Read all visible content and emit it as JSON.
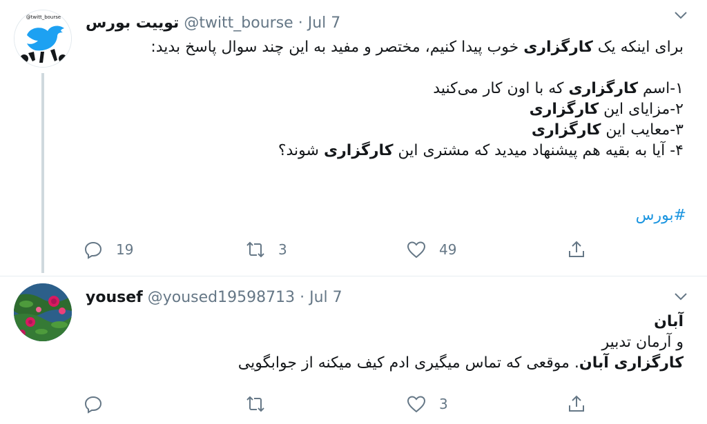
{
  "tweets": [
    {
      "display_name": "توییت بورس",
      "handle": "@twitt_bourse",
      "separator": "·",
      "date": "Jul 7",
      "avatar": {
        "text": "@twitt_bourse",
        "icon": "twitter-bird-icon",
        "accent": "#1da1f2"
      },
      "body": [
        {
          "parts": [
            {
              "t": "برای اینکه یک "
            },
            {
              "t": "کارگزاری",
              "b": true
            },
            {
              "t": " خوب پیدا کنیم، مختصر و مفید به این چند سوال پاسخ بدید:"
            }
          ]
        },
        {
          "parts": [
            {
              "t": " "
            }
          ]
        },
        {
          "parts": [
            {
              "t": "۱-اسم "
            },
            {
              "t": "کارگزاری",
              "b": true
            },
            {
              "t": " که با اون کار می‌کنید"
            }
          ]
        },
        {
          "parts": [
            {
              "t": "۲-مزایای این "
            },
            {
              "t": "کارگزاری",
              "b": true
            }
          ]
        },
        {
          "parts": [
            {
              "t": "۳-معایب این "
            },
            {
              "t": "کارگزاری",
              "b": true
            }
          ]
        },
        {
          "parts": [
            {
              "t": "۴- آیا به بقیه هم پیشنهاد میدید که مشتری این "
            },
            {
              "t": "کارگزاری",
              "b": true
            },
            {
              "t": " شوند؟"
            }
          ]
        }
      ],
      "hashtag": "#بورس",
      "actions": {
        "reply_count": "19",
        "retweet_count": "3",
        "like_count": "49"
      }
    },
    {
      "display_name": "yousef",
      "handle": "@yoused19598713",
      "separator": "·",
      "date": "Jul 7",
      "avatar": {
        "icon": "flower-photo-avatar"
      },
      "body": [
        {
          "parts": [
            {
              "t": "آبان",
              "b": true
            }
          ]
        },
        {
          "parts": [
            {
              "t": "و آرمان تدبیر"
            }
          ]
        },
        {
          "parts": [
            {
              "t": "کارگزاری آبان",
              "b": true
            },
            {
              "t": ". موقعی که تماس میگیری ادم کیف میکنه از جوابگویی"
            }
          ]
        }
      ],
      "actions": {
        "reply_count": "",
        "retweet_count": "",
        "like_count": "3"
      }
    }
  ],
  "colors": {
    "text": "#14171a",
    "muted": "#657786",
    "link": "#1b95e0",
    "thread": "#cfd9de"
  }
}
